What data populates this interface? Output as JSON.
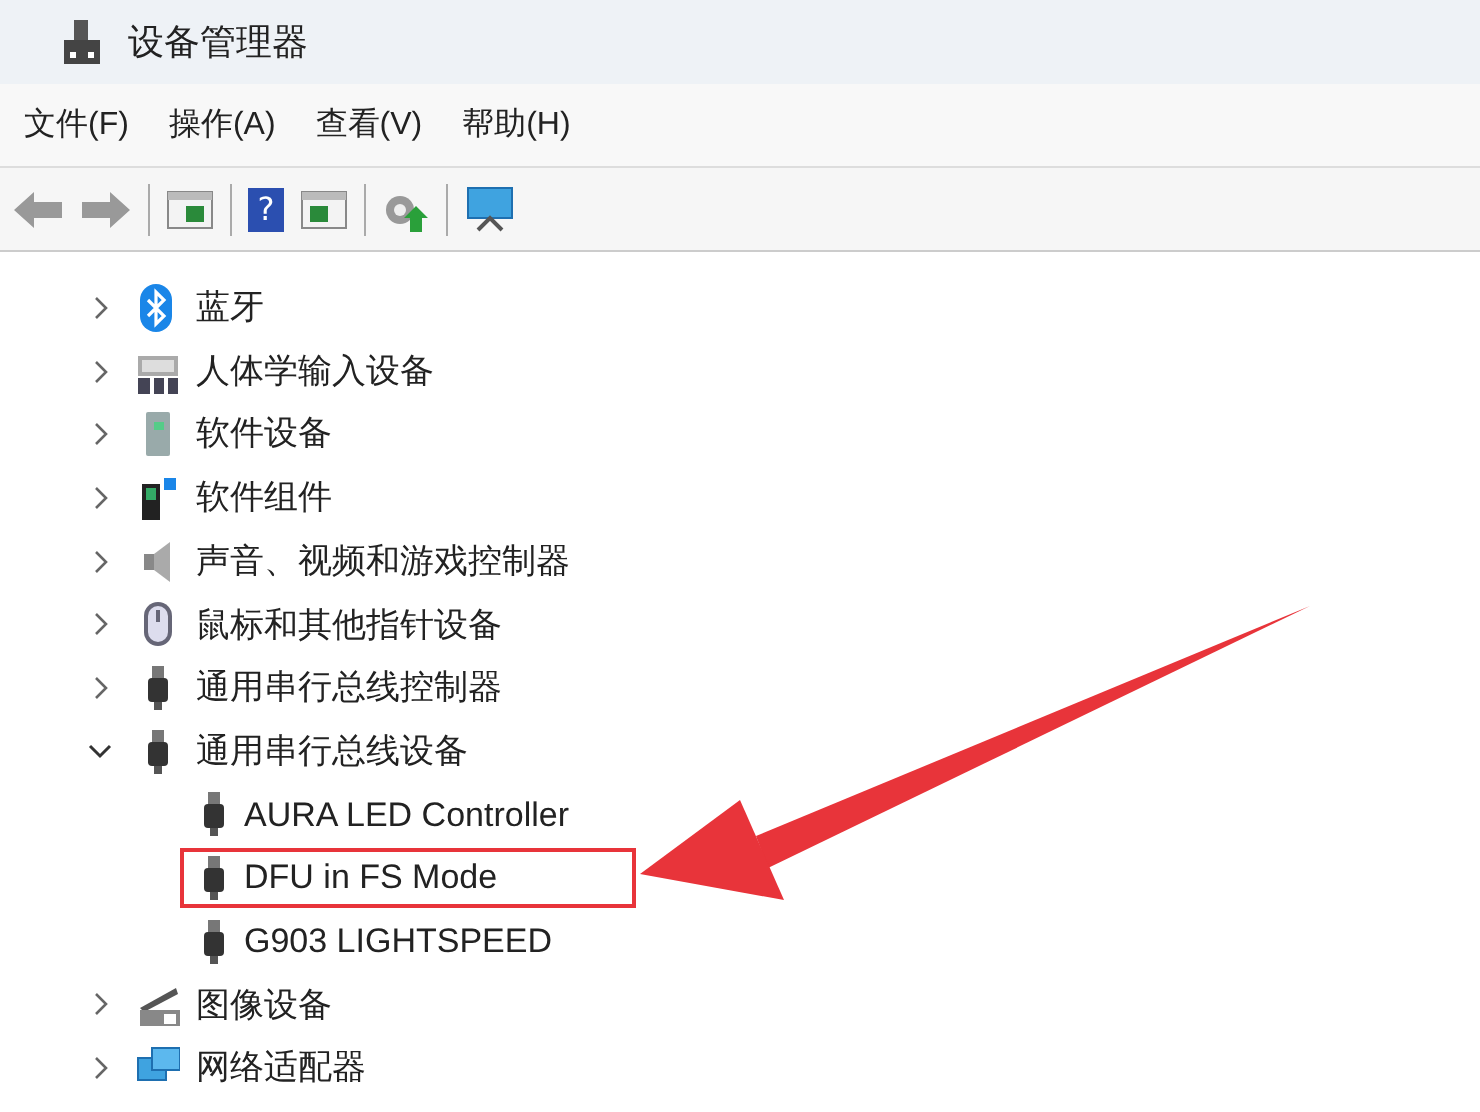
{
  "window": {
    "title": "设备管理器"
  },
  "menu": [
    "文件(F)",
    "操作(A)",
    "查看(V)",
    "帮助(H)"
  ],
  "toolbar": {
    "help_glyph": "?"
  },
  "tree": [
    {
      "label": "蓝牙",
      "expanded": false
    },
    {
      "label": "人体学输入设备",
      "expanded": false
    },
    {
      "label": "软件设备",
      "expanded": false
    },
    {
      "label": "软件组件",
      "expanded": false
    },
    {
      "label": "声音、视频和游戏控制器",
      "expanded": false
    },
    {
      "label": "鼠标和其他指针设备",
      "expanded": false
    },
    {
      "label": "通用串行总线控制器",
      "expanded": false
    },
    {
      "label": "通用串行总线设备",
      "expanded": true,
      "children": [
        {
          "label": "AURA LED Controller",
          "highlighted": false
        },
        {
          "label": "DFU in FS Mode",
          "highlighted": true
        },
        {
          "label": "G903 LIGHTSPEED",
          "highlighted": false
        }
      ]
    },
    {
      "label": "图像设备",
      "expanded": false
    },
    {
      "label": "网络适配器",
      "expanded": false
    }
  ]
}
